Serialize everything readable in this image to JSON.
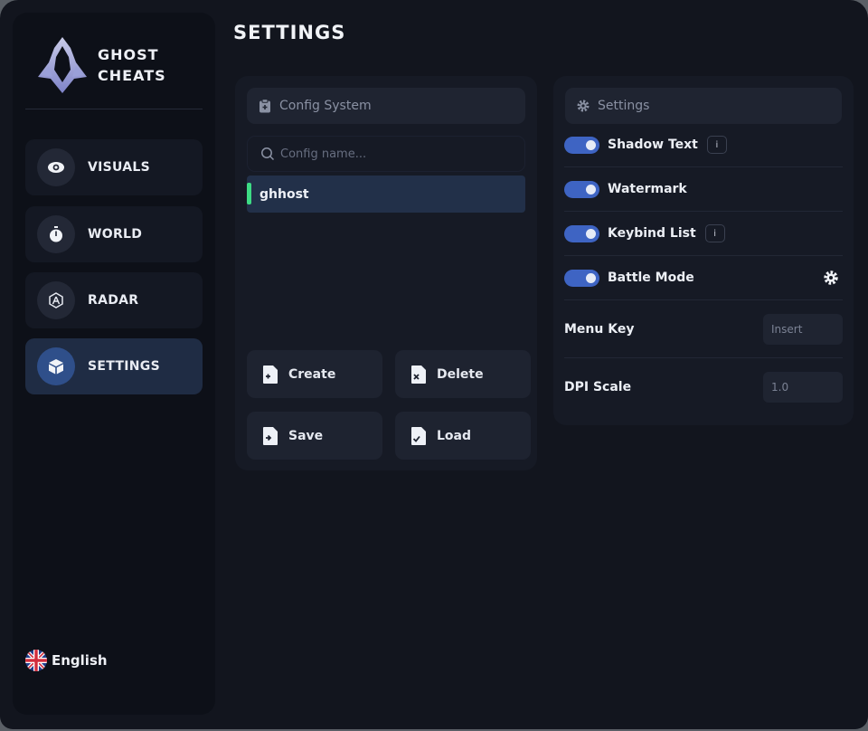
{
  "brand": {
    "line1": "GHOST",
    "line2": "CHEATS"
  },
  "sidebar": {
    "items": [
      {
        "label": "VISUALS",
        "icon": "eye-icon"
      },
      {
        "label": "WORLD",
        "icon": "stopwatch-icon"
      },
      {
        "label": "RADAR",
        "icon": "radar-icon"
      },
      {
        "label": "SETTINGS",
        "icon": "box-icon",
        "active": true
      }
    ],
    "language": "English"
  },
  "page": {
    "title": "SETTINGS"
  },
  "config_panel": {
    "title": "Config System",
    "search_placeholder": "Config name...",
    "configs": [
      {
        "name": "ghhost",
        "selected": true
      }
    ],
    "buttons": {
      "create": "Create",
      "delete": "Delete",
      "save": "Save",
      "load": "Load"
    }
  },
  "settings_panel": {
    "title": "Settings",
    "toggles": [
      {
        "label": "Shadow Text",
        "on": true,
        "info": "i"
      },
      {
        "label": "Watermark",
        "on": true
      },
      {
        "label": "Keybind List",
        "on": true,
        "info": "i"
      },
      {
        "label": "Battle Mode",
        "on": true,
        "has_gear": true
      }
    ],
    "menu_key": {
      "label": "Menu Key",
      "placeholder": "Insert"
    },
    "dpi_scale": {
      "label": "DPI Scale",
      "placeholder": "1.0"
    }
  },
  "colors": {
    "background": "#12151e",
    "sidebar": "#0d1018",
    "panel": "#161a25",
    "accent": "#3e64c3",
    "active_nav": "#1f2c44",
    "selected_marker": "#3ddc84"
  }
}
